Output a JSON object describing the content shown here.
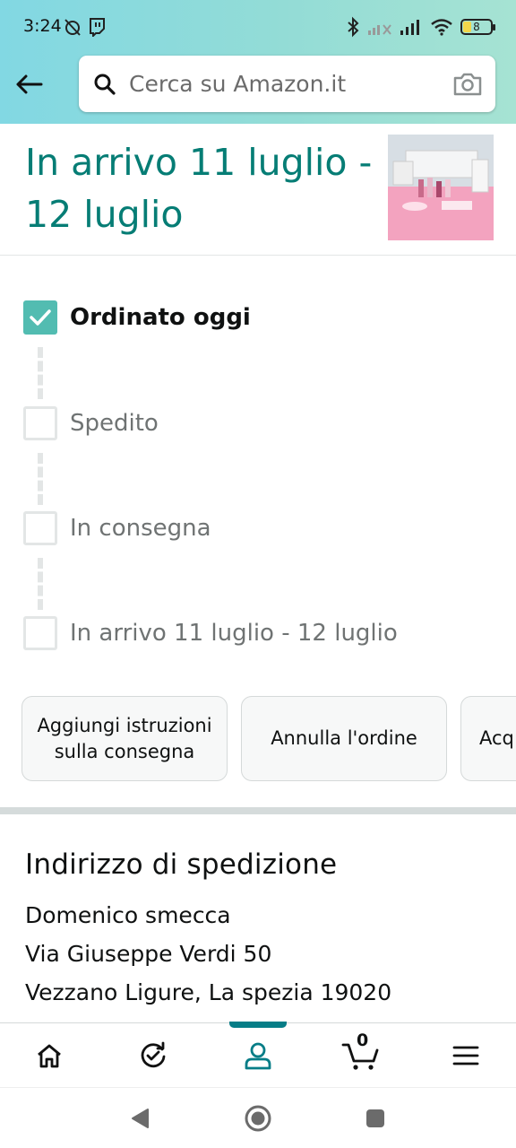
{
  "status_bar": {
    "time": "3:24",
    "battery_level": "8"
  },
  "search": {
    "placeholder": "Cerca su Amazon.it"
  },
  "delivery": {
    "title": "In arrivo 11 luglio - 12 luglio"
  },
  "tracking": {
    "steps": [
      {
        "label": "Ordinato oggi",
        "done": true
      },
      {
        "label": "Spedito",
        "done": false
      },
      {
        "label": "In consegna",
        "done": false
      },
      {
        "label": "In arrivo 11 luglio - 12 luglio",
        "done": false
      }
    ]
  },
  "actions": [
    {
      "label": "Aggiungi istruzioni sulla consegna"
    },
    {
      "label": "Annulla l'ordine"
    },
    {
      "label": "Acq"
    }
  ],
  "shipping_address": {
    "heading": "Indirizzo di spedizione",
    "name": "Domenico smecca",
    "street": "Via Giuseppe Verdi 50",
    "city_line": "Vezzano Ligure, La spezia 19020"
  },
  "bottom_nav": {
    "items": [
      "home-icon",
      "history-icon",
      "account-icon",
      "cart-icon",
      "menu-icon"
    ],
    "active": "account-icon",
    "cart_count": "0"
  },
  "colors": {
    "accent": "#067d75",
    "checkbox_done": "#52bcb1",
    "header_gradient_start": "#82d8e3",
    "header_gradient_end": "#a6e3d3"
  }
}
